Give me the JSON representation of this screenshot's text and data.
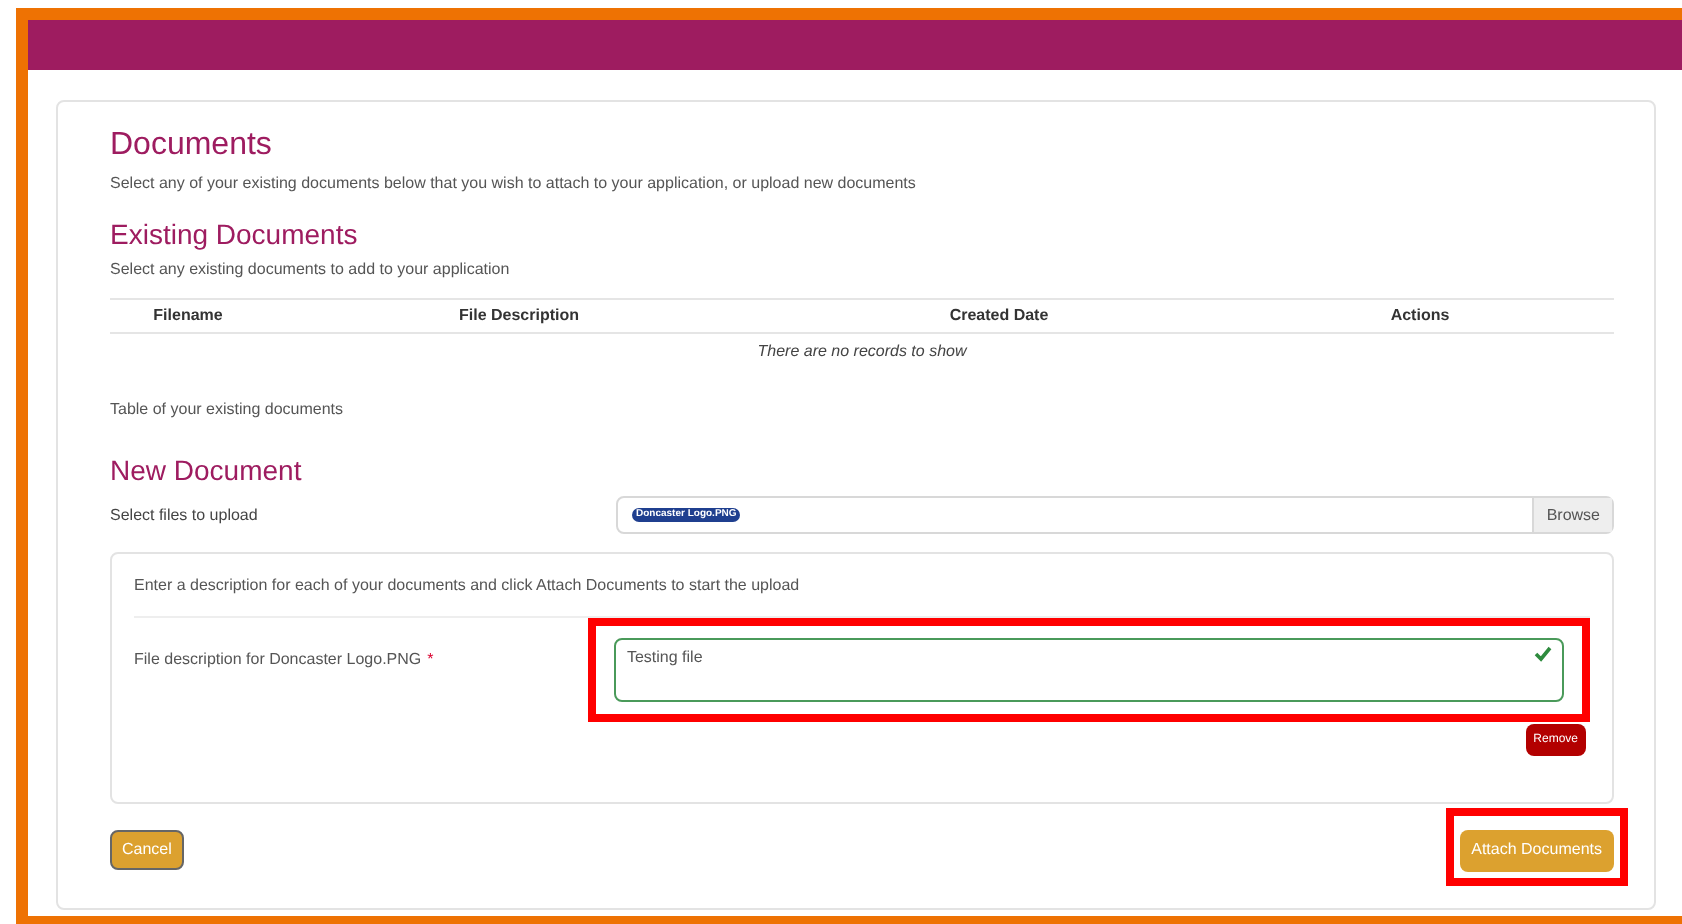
{
  "page": {
    "title": "Documents",
    "description": "Select any of your existing documents below that you wish to attach to your application, or upload new documents"
  },
  "existing": {
    "title": "Existing Documents",
    "description": "Select any existing documents to add to your application",
    "table": {
      "columns": [
        "Filename",
        "File Description",
        "Created Date",
        "Actions"
      ],
      "empty_message": "There are no records to show"
    },
    "caption": "Table of your existing documents"
  },
  "new_document": {
    "title": "New Document",
    "upload_label": "Select files to upload",
    "files": [
      {
        "name": "Doncaster Logo.PNG"
      }
    ],
    "browse": "Browse",
    "instructions": "Enter a description for each of your documents and click Attach Documents to start the upload",
    "description_fields": [
      {
        "label": "File description for Doncaster Logo.PNG",
        "required": true,
        "required_mark": "*",
        "value": "Testing file",
        "valid": true,
        "highlighted": true,
        "remove": "Remove"
      }
    ]
  },
  "buttons": {
    "cancel": {
      "label": "Cancel",
      "highlighted": false
    },
    "attach": {
      "label": "Attach Documents",
      "highlighted": true
    }
  }
}
